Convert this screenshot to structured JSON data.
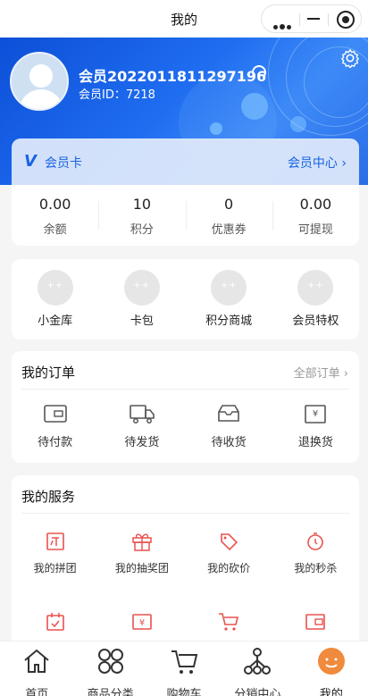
{
  "navbar": {
    "title": "我的"
  },
  "user": {
    "name": "会员2022011811297196",
    "id_label": "会员ID：",
    "id": "7218"
  },
  "member_card": {
    "label": "会员卡",
    "center_link": "会员中心"
  },
  "stats": [
    {
      "value": "0.00",
      "label": "余额"
    },
    {
      "value": "10",
      "label": "积分"
    },
    {
      "value": "0",
      "label": "优惠券"
    },
    {
      "value": "0.00",
      "label": "可提现"
    }
  ],
  "quick": [
    {
      "label": "小金库",
      "icon": "vault-icon"
    },
    {
      "label": "卡包",
      "icon": "card-pack-icon"
    },
    {
      "label": "积分商城",
      "icon": "points-mall-icon"
    },
    {
      "label": "会员特权",
      "icon": "member-privilege-icon"
    }
  ],
  "orders": {
    "title": "我的订单",
    "all": "全部订单",
    "items": [
      {
        "label": "待付款",
        "icon": "wallet-icon"
      },
      {
        "label": "待发货",
        "icon": "truck-icon"
      },
      {
        "label": "待收货",
        "icon": "inbox-icon"
      },
      {
        "label": "退换货",
        "icon": "refund-icon"
      }
    ]
  },
  "services": {
    "title": "我的服务",
    "items": [
      {
        "label": "我的拼团",
        "icon": "group-buy-icon"
      },
      {
        "label": "我的抽奖团",
        "icon": "gift-icon"
      },
      {
        "label": "我的砍价",
        "icon": "bargain-tag-icon"
      },
      {
        "label": "我的秒杀",
        "icon": "stopwatch-icon"
      },
      {
        "label": "",
        "icon": "calendar-icon"
      },
      {
        "label": "",
        "icon": "yen-ticket-icon"
      },
      {
        "label": "",
        "icon": "cart-icon"
      },
      {
        "label": "",
        "icon": "wallet-icon"
      }
    ]
  },
  "tabbar": [
    {
      "label": "首页",
      "icon": "home-icon"
    },
    {
      "label": "商品分类",
      "icon": "category-icon"
    },
    {
      "label": "购物车",
      "icon": "cart-icon"
    },
    {
      "label": "分销中心",
      "icon": "share-network-icon"
    },
    {
      "label": "我的",
      "icon": "profile-icon"
    }
  ],
  "colors": {
    "primary": "#1a63e3",
    "accent": "#e8524f",
    "active_tab": "#f08a3c"
  }
}
